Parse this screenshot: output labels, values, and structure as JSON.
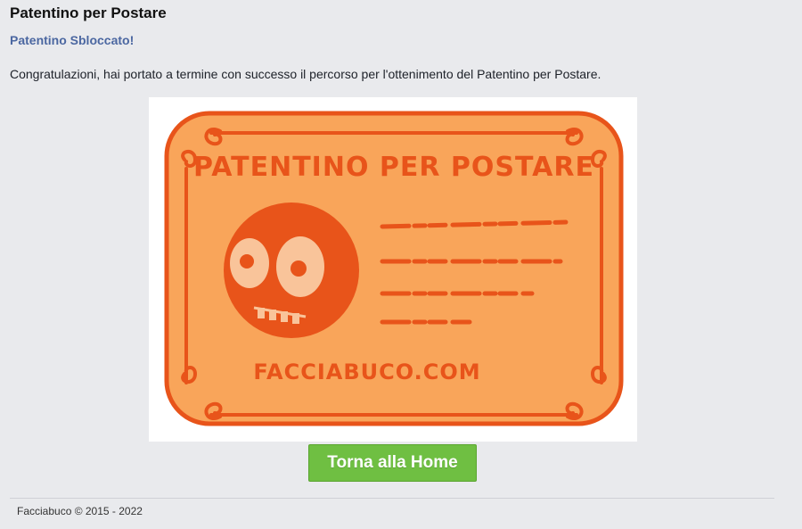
{
  "header": {
    "title": "Patentino per Postare",
    "subtitle": "Patentino Sbloccato!"
  },
  "main": {
    "message": "Congratulazioni, hai portato a termine con successo il percorso per l'ottenimento del Patentino per Postare.",
    "license_card": {
      "heading": "PATENTINO PER POSTARE",
      "website": "FACCIABUCO.COM",
      "icon": "smiley-face-icon"
    },
    "home_button_label": "Torna alla Home"
  },
  "footer": {
    "copyright": "Facciabuco © 2015 - 2022"
  },
  "colors": {
    "background": "#e9eaed",
    "subtitle": "#4b67a1",
    "button": "#6fbf42",
    "card_fill": "#f9a55a",
    "card_ink": "#e8541a"
  }
}
